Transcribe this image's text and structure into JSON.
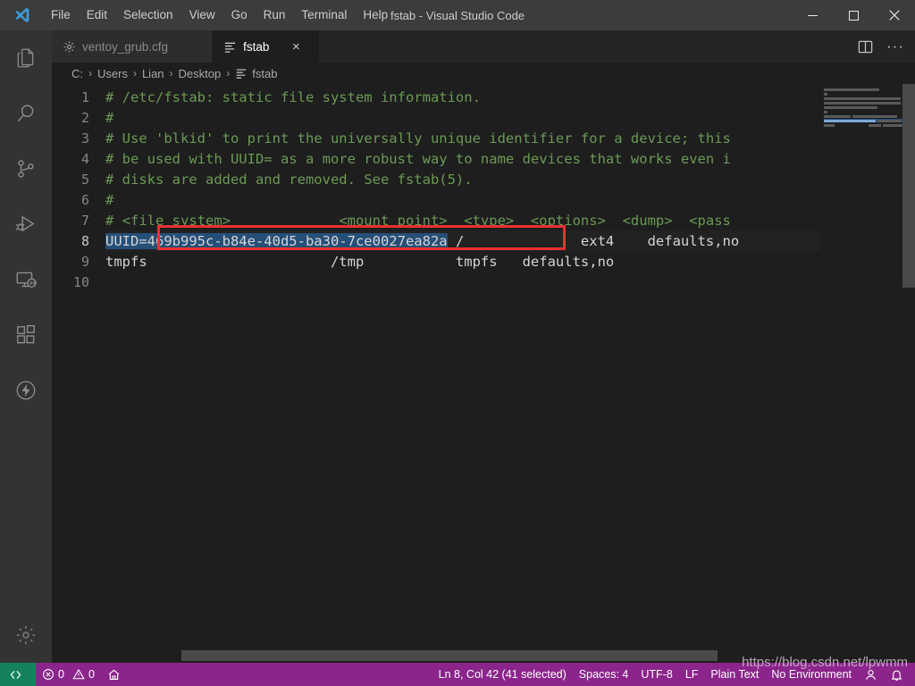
{
  "window": {
    "title": "fstab - Visual Studio Code",
    "controls": {
      "minimize": "minimize-icon",
      "maximize": "maximize-icon",
      "close": "close-icon"
    }
  },
  "menubar": {
    "logo": "vscode-logo-icon",
    "items": [
      {
        "label": "File"
      },
      {
        "label": "Edit"
      },
      {
        "label": "Selection"
      },
      {
        "label": "View"
      },
      {
        "label": "Go"
      },
      {
        "label": "Run"
      },
      {
        "label": "Terminal"
      },
      {
        "label": "Help"
      }
    ]
  },
  "activitybar": {
    "items": [
      {
        "name": "explorer",
        "icon": "files-icon",
        "active": false
      },
      {
        "name": "search",
        "icon": "search-icon",
        "active": false
      },
      {
        "name": "source-control",
        "icon": "source-control-icon",
        "active": false
      },
      {
        "name": "run-and-debug",
        "icon": "run-debug-icon",
        "active": false
      },
      {
        "name": "remote-explorer",
        "icon": "remote-explorer-icon",
        "active": false
      },
      {
        "name": "extensions",
        "icon": "extensions-icon",
        "active": false
      },
      {
        "name": "lightning",
        "icon": "lightning-bolt-icon",
        "active": false
      }
    ],
    "bottom": [
      {
        "name": "manage",
        "icon": "gear-icon"
      }
    ]
  },
  "tabs": {
    "items": [
      {
        "label": "ventoy_grub.cfg",
        "icon": "gear-file-icon",
        "active": false,
        "close": "×"
      },
      {
        "label": "fstab",
        "icon": "plaintext-file-icon",
        "active": true,
        "close": "×"
      }
    ],
    "actions": [
      {
        "name": "split-editor",
        "icon": "split-editor-icon"
      },
      {
        "name": "more-actions",
        "icon": "ellipsis-icon",
        "glyph": "···"
      }
    ]
  },
  "breadcrumbs": {
    "separator": "›",
    "items": [
      {
        "label": "C:",
        "icon": ""
      },
      {
        "label": "Users",
        "icon": ""
      },
      {
        "label": "Lian",
        "icon": ""
      },
      {
        "label": "Desktop",
        "icon": ""
      },
      {
        "label": "fstab",
        "icon": "plaintext-file-icon"
      }
    ]
  },
  "editor": {
    "language": "Plain Text",
    "current_line": 8,
    "lines": [
      {
        "n": "1",
        "kind": "comment",
        "text": "# /etc/fstab: static file system information."
      },
      {
        "n": "2",
        "kind": "comment",
        "text": "#"
      },
      {
        "n": "3",
        "kind": "comment",
        "text": "# Use 'blkid' to print the universally unique identifier for a device; this"
      },
      {
        "n": "4",
        "kind": "comment",
        "text": "# be used with UUID= as a more robust way to name devices that works even i"
      },
      {
        "n": "5",
        "kind": "comment",
        "text": "# disks are added and removed. See fstab(5)."
      },
      {
        "n": "6",
        "kind": "comment",
        "text": "#"
      },
      {
        "n": "7",
        "kind": "comment",
        "text": "# <file system>             <mount point>  <type>  <options>  <dump>  <pass"
      },
      {
        "n": "8",
        "kind": "selected",
        "selected_text": "UUID=469b995c-b84e-40d5-ba30-7ce0027ea82a",
        "text": " /              ext4    defaults,no"
      },
      {
        "n": "9",
        "kind": "plain",
        "text": "tmpfs                      /tmp           tmpfs   defaults,no"
      },
      {
        "n": "10",
        "kind": "plain",
        "text": ""
      }
    ]
  },
  "statusbar": {
    "remote": {
      "icon": "remote-indicator-icon",
      "label": ""
    },
    "problems": {
      "errors_icon": "error-icon",
      "errors": "0",
      "warnings_icon": "warning-icon",
      "warnings": "0"
    },
    "home": {
      "icon": "home-icon"
    },
    "position": "Ln 8, Col 42 (41 selected)",
    "indentation": "Spaces: 4",
    "encoding": "UTF-8",
    "eol": "LF",
    "language_mode": "Plain Text",
    "environment": "No Environment",
    "account": {
      "icon": "account-icon"
    },
    "notifications": {
      "icon": "bell-icon"
    }
  },
  "watermark": {
    "text": "https://blog.csdn.net/lpwmm"
  },
  "colors": {
    "titlebar_bg": "#3c3c3c",
    "activitybar_bg": "#333333",
    "editor_bg": "#1e1e1e",
    "tabs_bg": "#252526",
    "statusbar_bg": "#8b258b",
    "remote_bg": "#16825d",
    "selection": "#264f78",
    "comment": "#6a9955",
    "annotation_box": "#e8312f"
  }
}
